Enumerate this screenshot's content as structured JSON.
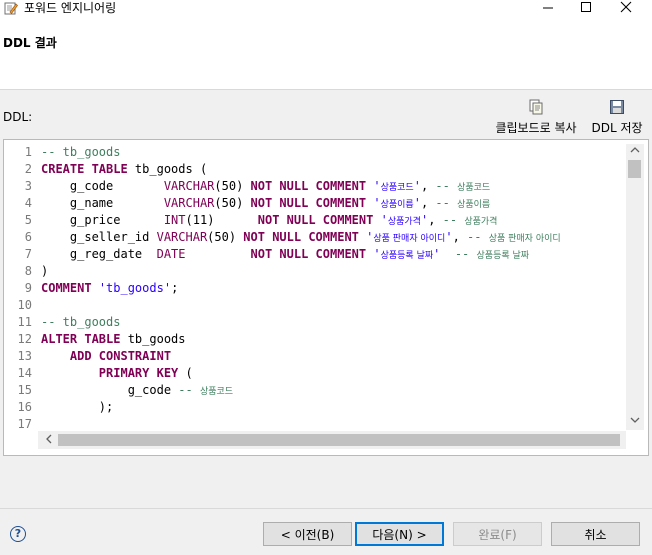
{
  "window": {
    "title": "포워드 엔지니어링",
    "app_icon": "pencil-document-icon"
  },
  "header": {
    "title": "DDL 결과"
  },
  "ddl": {
    "label": "DDL:",
    "copy_label": "클립보드로 복사",
    "save_label": "DDL 저장"
  },
  "code_lines": [
    {
      "n": "1",
      "tokens": [
        {
          "c": "cm",
          "t": "-- tb_goods"
        }
      ]
    },
    {
      "n": "2",
      "tokens": [
        {
          "c": "kw",
          "t": "CREATE TABLE"
        },
        {
          "c": "pl",
          "t": " tb_goods ("
        }
      ]
    },
    {
      "n": "3",
      "tokens": [
        {
          "c": "pl",
          "t": "    g_code       "
        },
        {
          "c": "tp",
          "t": "VARCHAR"
        },
        {
          "c": "pl",
          "t": "(50) "
        },
        {
          "c": "kw",
          "t": "NOT NULL COMMENT"
        },
        {
          "c": "pl",
          "t": " "
        },
        {
          "c": "st",
          "t": "'"
        },
        {
          "c": "st ko",
          "t": "상품코드"
        },
        {
          "c": "st",
          "t": "'"
        },
        {
          "c": "pl",
          "t": ", "
        },
        {
          "c": "cm",
          "t": "-- "
        },
        {
          "c": "cm ko",
          "t": "상품코드"
        }
      ]
    },
    {
      "n": "4",
      "tokens": [
        {
          "c": "pl",
          "t": "    g_name       "
        },
        {
          "c": "tp",
          "t": "VARCHAR"
        },
        {
          "c": "pl",
          "t": "(50) "
        },
        {
          "c": "kw",
          "t": "NOT NULL COMMENT"
        },
        {
          "c": "pl",
          "t": " "
        },
        {
          "c": "st",
          "t": "'"
        },
        {
          "c": "st ko",
          "t": "상품이름"
        },
        {
          "c": "st",
          "t": "'"
        },
        {
          "c": "pl",
          "t": ", "
        },
        {
          "c": "cm",
          "t": "-- "
        },
        {
          "c": "cm ko",
          "t": "상품이름"
        }
      ]
    },
    {
      "n": "5",
      "tokens": [
        {
          "c": "pl",
          "t": "    g_price      "
        },
        {
          "c": "tp",
          "t": "INT"
        },
        {
          "c": "pl",
          "t": "(11)      "
        },
        {
          "c": "kw",
          "t": "NOT NULL COMMENT"
        },
        {
          "c": "pl",
          "t": " "
        },
        {
          "c": "st",
          "t": "'"
        },
        {
          "c": "st ko",
          "t": "상품가격"
        },
        {
          "c": "st",
          "t": "'"
        },
        {
          "c": "pl",
          "t": ", "
        },
        {
          "c": "cm",
          "t": "-- "
        },
        {
          "c": "cm ko",
          "t": "상품가격"
        }
      ]
    },
    {
      "n": "6",
      "tokens": [
        {
          "c": "pl",
          "t": "    g_seller_id "
        },
        {
          "c": "tp",
          "t": "VARCHAR"
        },
        {
          "c": "pl",
          "t": "(50) "
        },
        {
          "c": "kw",
          "t": "NOT NULL COMMENT"
        },
        {
          "c": "pl",
          "t": " "
        },
        {
          "c": "st",
          "t": "'"
        },
        {
          "c": "st ko",
          "t": "상품 판매자 아이디"
        },
        {
          "c": "st",
          "t": "'"
        },
        {
          "c": "pl",
          "t": ", "
        },
        {
          "c": "cm",
          "t": "-- "
        },
        {
          "c": "cm ko",
          "t": "상품 판매자 아이디"
        }
      ]
    },
    {
      "n": "7",
      "tokens": [
        {
          "c": "pl",
          "t": "    g_reg_date  "
        },
        {
          "c": "tp",
          "t": "DATE"
        },
        {
          "c": "pl",
          "t": "         "
        },
        {
          "c": "kw",
          "t": "NOT NULL COMMENT"
        },
        {
          "c": "pl",
          "t": " "
        },
        {
          "c": "st",
          "t": "'"
        },
        {
          "c": "st ko",
          "t": "상품등록 날짜"
        },
        {
          "c": "st",
          "t": "'"
        },
        {
          "c": "pl",
          "t": "  "
        },
        {
          "c": "cm",
          "t": "-- "
        },
        {
          "c": "cm ko",
          "t": "상품등록 날짜"
        }
      ]
    },
    {
      "n": "8",
      "tokens": [
        {
          "c": "pl",
          "t": ")"
        }
      ]
    },
    {
      "n": "9",
      "tokens": [
        {
          "c": "kw",
          "t": "COMMENT"
        },
        {
          "c": "pl",
          "t": " "
        },
        {
          "c": "st",
          "t": "'tb_goods'"
        },
        {
          "c": "pl",
          "t": ";"
        }
      ]
    },
    {
      "n": "10",
      "tokens": []
    },
    {
      "n": "11",
      "tokens": [
        {
          "c": "cm",
          "t": "-- tb_goods"
        }
      ]
    },
    {
      "n": "12",
      "tokens": [
        {
          "c": "kw",
          "t": "ALTER TABLE"
        },
        {
          "c": "pl",
          "t": " tb_goods"
        }
      ]
    },
    {
      "n": "13",
      "tokens": [
        {
          "c": "pl",
          "t": "    "
        },
        {
          "c": "kw",
          "t": "ADD CONSTRAINT"
        }
      ]
    },
    {
      "n": "14",
      "tokens": [
        {
          "c": "pl",
          "t": "        "
        },
        {
          "c": "kw",
          "t": "PRIMARY KEY"
        },
        {
          "c": "pl",
          "t": " ("
        }
      ]
    },
    {
      "n": "15",
      "tokens": [
        {
          "c": "pl",
          "t": "            g_code "
        },
        {
          "c": "cm",
          "t": "-- "
        },
        {
          "c": "cm ko",
          "t": "상품코드"
        }
      ]
    },
    {
      "n": "16",
      "tokens": [
        {
          "c": "pl",
          "t": "        );"
        }
      ]
    },
    {
      "n": "17",
      "tokens": []
    }
  ],
  "buttons": {
    "prev": "< 이전(B)",
    "next": "다음(N) >",
    "finish": "완료(F)",
    "cancel": "취소"
  },
  "help_glyph": "?"
}
